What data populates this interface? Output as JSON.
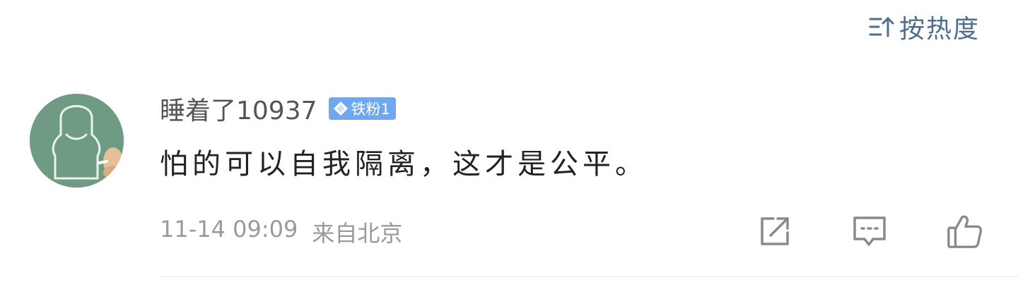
{
  "sort": {
    "label": "按热度",
    "icon": "sort-icon"
  },
  "comment": {
    "username": "睡着了10937",
    "badge": "铁粉1",
    "text": "怕的可以自我隔离，这才是公平。",
    "time": "11-14 09:09",
    "location": "来自北京"
  },
  "actions": {
    "share_icon": "share-icon",
    "reply_icon": "comment-icon",
    "like_icon": "thumbs-up-icon"
  },
  "colors": {
    "accent": "#506d8c",
    "badge": "#6fa8ef",
    "avatar_bg": "#6f9b85"
  }
}
